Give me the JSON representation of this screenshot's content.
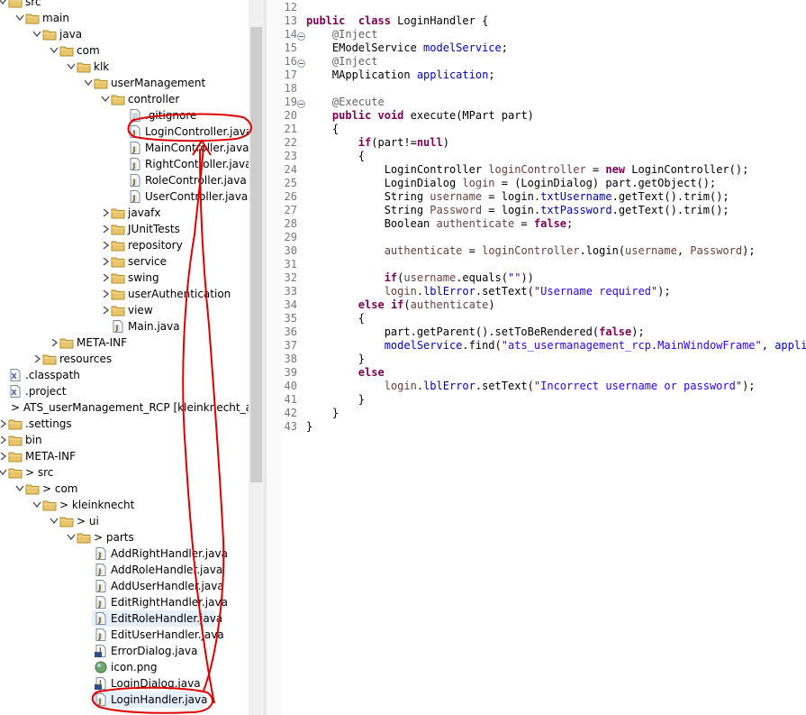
{
  "explorer": {
    "items": [
      {
        "label": "src",
        "depth": 0,
        "expanded": true,
        "icon": "folder",
        "selected": false,
        "decor": ""
      },
      {
        "label": "main",
        "depth": 1,
        "expanded": true,
        "icon": "folder",
        "selected": false,
        "decor": ""
      },
      {
        "label": "java",
        "depth": 2,
        "expanded": true,
        "icon": "folder",
        "selected": false,
        "decor": ""
      },
      {
        "label": "com",
        "depth": 3,
        "expanded": true,
        "icon": "folder",
        "selected": false,
        "decor": ""
      },
      {
        "label": "klk",
        "depth": 4,
        "expanded": true,
        "icon": "folder",
        "selected": false,
        "decor": ""
      },
      {
        "label": "userManagement",
        "depth": 5,
        "expanded": true,
        "icon": "folder",
        "selected": false,
        "decor": ""
      },
      {
        "label": "controller",
        "depth": 6,
        "expanded": true,
        "icon": "folder",
        "selected": false,
        "decor": ""
      },
      {
        "label": ".gitignore",
        "depth": 7,
        "expanded": null,
        "icon": "text-file",
        "selected": false,
        "decor": ""
      },
      {
        "label": "LoginController.java",
        "depth": 7,
        "expanded": null,
        "icon": "java-file",
        "selected": false,
        "decor": "circled"
      },
      {
        "label": "MainController.java",
        "depth": 7,
        "expanded": null,
        "icon": "java-file",
        "selected": false,
        "decor": ""
      },
      {
        "label": "RightController.java",
        "depth": 7,
        "expanded": null,
        "icon": "java-file",
        "selected": false,
        "decor": ""
      },
      {
        "label": "RoleController.java",
        "depth": 7,
        "expanded": null,
        "icon": "java-file",
        "selected": false,
        "decor": ""
      },
      {
        "label": "UserController.java",
        "depth": 7,
        "expanded": null,
        "icon": "java-file",
        "selected": false,
        "decor": ""
      },
      {
        "label": "javafx",
        "depth": 6,
        "expanded": false,
        "icon": "folder",
        "selected": false,
        "decor": ""
      },
      {
        "label": "JUnitTests",
        "depth": 6,
        "expanded": false,
        "icon": "folder",
        "selected": false,
        "decor": ""
      },
      {
        "label": "repository",
        "depth": 6,
        "expanded": false,
        "icon": "folder",
        "selected": false,
        "decor": ""
      },
      {
        "label": "service",
        "depth": 6,
        "expanded": false,
        "icon": "folder",
        "selected": false,
        "decor": ""
      },
      {
        "label": "swing",
        "depth": 6,
        "expanded": false,
        "icon": "folder",
        "selected": false,
        "decor": ""
      },
      {
        "label": "userAuthentication",
        "depth": 6,
        "expanded": false,
        "icon": "folder",
        "selected": false,
        "decor": ""
      },
      {
        "label": "view",
        "depth": 6,
        "expanded": false,
        "icon": "folder",
        "selected": false,
        "decor": ""
      },
      {
        "label": "Main.java",
        "depth": 6,
        "expanded": null,
        "icon": "java-file",
        "selected": false,
        "decor": ""
      },
      {
        "label": "META-INF",
        "depth": 3,
        "expanded": false,
        "icon": "folder",
        "selected": false,
        "decor": ""
      },
      {
        "label": "resources",
        "depth": 2,
        "expanded": false,
        "icon": "folder",
        "selected": false,
        "decor": ""
      },
      {
        "label": ".classpath",
        "depth": 0,
        "expanded": null,
        "icon": "xml-file",
        "selected": false,
        "decor": ""
      },
      {
        "label": ".project",
        "depth": 0,
        "expanded": null,
        "icon": "xml-file",
        "selected": false,
        "decor": ""
      },
      {
        "label": "> ATS_userManagement_RCP [kleinknecht_ats dev]",
        "depth": -1,
        "expanded": false,
        "icon": "none",
        "selected": false,
        "decor": ""
      },
      {
        "label": ".settings",
        "depth": 0,
        "expanded": false,
        "icon": "folder",
        "selected": false,
        "decor": ""
      },
      {
        "label": "bin",
        "depth": 0,
        "expanded": false,
        "icon": "folder",
        "selected": false,
        "decor": ""
      },
      {
        "label": "META-INF",
        "depth": 0,
        "expanded": false,
        "icon": "folder",
        "selected": false,
        "decor": ""
      },
      {
        "label": "> src",
        "depth": 0,
        "expanded": true,
        "icon": "folder",
        "selected": false,
        "decor": ""
      },
      {
        "label": "> com",
        "depth": 1,
        "expanded": true,
        "icon": "folder",
        "selected": false,
        "decor": ""
      },
      {
        "label": "> kleinknecht",
        "depth": 2,
        "expanded": true,
        "icon": "folder",
        "selected": false,
        "decor": ""
      },
      {
        "label": "> ui",
        "depth": 3,
        "expanded": true,
        "icon": "folder",
        "selected": false,
        "decor": ""
      },
      {
        "label": "> parts",
        "depth": 4,
        "expanded": true,
        "icon": "folder",
        "selected": false,
        "decor": ""
      },
      {
        "label": "AddRightHandler.java",
        "depth": 5,
        "expanded": null,
        "icon": "java-file",
        "selected": false,
        "decor": ""
      },
      {
        "label": "AddRoleHandler.java",
        "depth": 5,
        "expanded": null,
        "icon": "java-file",
        "selected": false,
        "decor": ""
      },
      {
        "label": "AddUserHandler.java",
        "depth": 5,
        "expanded": null,
        "icon": "java-file",
        "selected": false,
        "decor": ""
      },
      {
        "label": "EditRightHandler.java",
        "depth": 5,
        "expanded": null,
        "icon": "java-file",
        "selected": false,
        "decor": ""
      },
      {
        "label": "EditRoleHandler.java",
        "depth": 5,
        "expanded": null,
        "icon": "java-file",
        "selected": true,
        "decor": ""
      },
      {
        "label": "EditUserHandler.java",
        "depth": 5,
        "expanded": null,
        "icon": "java-file",
        "selected": false,
        "decor": ""
      },
      {
        "label": "ErrorDialog.java",
        "depth": 5,
        "expanded": null,
        "icon": "java-class-file",
        "selected": false,
        "decor": ""
      },
      {
        "label": "icon.png",
        "depth": 5,
        "expanded": null,
        "icon": "image-file",
        "selected": false,
        "decor": ""
      },
      {
        "label": "LoginDialog.java",
        "depth": 5,
        "expanded": null,
        "icon": "java-class-file",
        "selected": false,
        "decor": ""
      },
      {
        "label": "LoginHandler.java",
        "depth": 5,
        "expanded": null,
        "icon": "java-file",
        "selected": true,
        "decor": "circled"
      }
    ]
  },
  "editor": {
    "lines": [
      {
        "n": "12",
        "fold": false,
        "tokens": []
      },
      {
        "n": "13",
        "fold": false,
        "tokens": [
          [
            "kw",
            "public"
          ],
          [
            "",
            "  "
          ],
          [
            "kw",
            "class"
          ],
          [
            "",
            " LoginHandler {"
          ]
        ]
      },
      {
        "n": "14",
        "fold": true,
        "tokens": [
          [
            "",
            "    "
          ],
          [
            "ann",
            "@Inject"
          ]
        ]
      },
      {
        "n": "15",
        "fold": false,
        "tokens": [
          [
            "",
            "    EModelService "
          ],
          [
            "fld",
            "modelService"
          ],
          [
            "",
            ";"
          ]
        ]
      },
      {
        "n": "16",
        "fold": true,
        "tokens": [
          [
            "",
            "    "
          ],
          [
            "ann",
            "@Inject"
          ]
        ]
      },
      {
        "n": "17",
        "fold": false,
        "tokens": [
          [
            "",
            "    MApplication "
          ],
          [
            "fld",
            "application"
          ],
          [
            "",
            ";"
          ]
        ]
      },
      {
        "n": "18",
        "fold": false,
        "tokens": []
      },
      {
        "n": "19",
        "fold": true,
        "tokens": [
          [
            "",
            "    "
          ],
          [
            "ann",
            "@Execute"
          ]
        ]
      },
      {
        "n": "20",
        "fold": false,
        "tokens": [
          [
            "",
            "    "
          ],
          [
            "kw",
            "public"
          ],
          [
            "",
            " "
          ],
          [
            "kw",
            "void"
          ],
          [
            "",
            " execute(MPart part)"
          ]
        ]
      },
      {
        "n": "21",
        "fold": false,
        "tokens": [
          [
            "",
            "    {"
          ]
        ]
      },
      {
        "n": "22",
        "fold": false,
        "tokens": [
          [
            "",
            "        "
          ],
          [
            "kw",
            "if"
          ],
          [
            "",
            "(part!="
          ],
          [
            "kw",
            "null"
          ],
          [
            "",
            ")"
          ]
        ]
      },
      {
        "n": "23",
        "fold": false,
        "tokens": [
          [
            "",
            "        {"
          ]
        ]
      },
      {
        "n": "24",
        "fold": false,
        "tokens": [
          [
            "",
            "            LoginController "
          ],
          [
            "nv",
            "loginController"
          ],
          [
            "",
            " = "
          ],
          [
            "kw",
            "new"
          ],
          [
            "",
            " LoginController();"
          ]
        ]
      },
      {
        "n": "25",
        "fold": false,
        "tokens": [
          [
            "",
            "            LoginDialog "
          ],
          [
            "nv",
            "login"
          ],
          [
            "",
            " = (LoginDialog) part.getObject();"
          ]
        ]
      },
      {
        "n": "26",
        "fold": false,
        "tokens": [
          [
            "",
            "            String "
          ],
          [
            "nv",
            "username"
          ],
          [
            "",
            " = login."
          ],
          [
            "fld",
            "txtUsername"
          ],
          [
            "",
            ".getText().trim();"
          ]
        ]
      },
      {
        "n": "27",
        "fold": false,
        "tokens": [
          [
            "",
            "            String "
          ],
          [
            "nv",
            "Password"
          ],
          [
            "",
            " = login."
          ],
          [
            "fld",
            "txtPassword"
          ],
          [
            "",
            ".getText().trim();"
          ]
        ]
      },
      {
        "n": "28",
        "fold": false,
        "tokens": [
          [
            "",
            "            Boolean "
          ],
          [
            "nv",
            "authenticate"
          ],
          [
            "",
            " = "
          ],
          [
            "kw",
            "false"
          ],
          [
            "",
            ";"
          ]
        ]
      },
      {
        "n": "29",
        "fold": false,
        "tokens": []
      },
      {
        "n": "30",
        "fold": false,
        "tokens": [
          [
            "",
            "            "
          ],
          [
            "nv",
            "authenticate"
          ],
          [
            "",
            " = "
          ],
          [
            "nv",
            "loginController"
          ],
          [
            "",
            ".login("
          ],
          [
            "nv",
            "username"
          ],
          [
            "",
            ", "
          ],
          [
            "nv",
            "Password"
          ],
          [
            "",
            ");"
          ]
        ]
      },
      {
        "n": "31",
        "fold": false,
        "tokens": []
      },
      {
        "n": "32",
        "fold": false,
        "tokens": [
          [
            "",
            "            "
          ],
          [
            "kw",
            "if"
          ],
          [
            "",
            "("
          ],
          [
            "nv",
            "username"
          ],
          [
            "",
            ".equals("
          ],
          [
            "str",
            "\"\""
          ],
          [
            "",
            "))"
          ]
        ]
      },
      {
        "n": "33",
        "fold": false,
        "tokens": [
          [
            "",
            "            "
          ],
          [
            "nv",
            "login"
          ],
          [
            "",
            "."
          ],
          [
            "fld",
            "lblError"
          ],
          [
            "",
            ".setText("
          ],
          [
            "str",
            "\"Username required\""
          ],
          [
            "",
            ");"
          ]
        ]
      },
      {
        "n": "34",
        "fold": false,
        "tokens": [
          [
            "",
            "        "
          ],
          [
            "kw",
            "else"
          ],
          [
            "",
            " "
          ],
          [
            "kw",
            "if"
          ],
          [
            "",
            "("
          ],
          [
            "nv",
            "authenticate"
          ],
          [
            "",
            ")"
          ]
        ]
      },
      {
        "n": "35",
        "fold": false,
        "tokens": [
          [
            "",
            "        {"
          ]
        ]
      },
      {
        "n": "36",
        "fold": false,
        "tokens": [
          [
            "",
            "            part.getParent().setToBeRendered("
          ],
          [
            "kw",
            "false"
          ],
          [
            "",
            ");"
          ]
        ]
      },
      {
        "n": "37",
        "fold": false,
        "tokens": [
          [
            "",
            "            "
          ],
          [
            "fld",
            "modelService"
          ],
          [
            "",
            ".find("
          ],
          [
            "str",
            "\"ats_usermanagement_rcp.MainWindowFrame\""
          ],
          [
            "",
            ", "
          ],
          [
            "fld",
            "applicati"
          ]
        ]
      },
      {
        "n": "38",
        "fold": false,
        "tokens": [
          [
            "",
            "        }"
          ]
        ]
      },
      {
        "n": "39",
        "fold": false,
        "tokens": [
          [
            "",
            "        "
          ],
          [
            "kw",
            "else"
          ]
        ]
      },
      {
        "n": "40",
        "fold": false,
        "tokens": [
          [
            "",
            "            "
          ],
          [
            "nv",
            "login"
          ],
          [
            "",
            "."
          ],
          [
            "fld",
            "lblError"
          ],
          [
            "",
            ".setText("
          ],
          [
            "str",
            "\"Incorrect username or password\""
          ],
          [
            "",
            ");"
          ]
        ]
      },
      {
        "n": "41",
        "fold": false,
        "tokens": [
          [
            "",
            "        }"
          ]
        ]
      },
      {
        "n": "42",
        "fold": false,
        "tokens": [
          [
            "",
            "    }"
          ]
        ]
      },
      {
        "n": "43",
        "fold": false,
        "tokens": [
          [
            "",
            "}"
          ]
        ]
      }
    ]
  },
  "annotation": {
    "color": "#e00000"
  }
}
